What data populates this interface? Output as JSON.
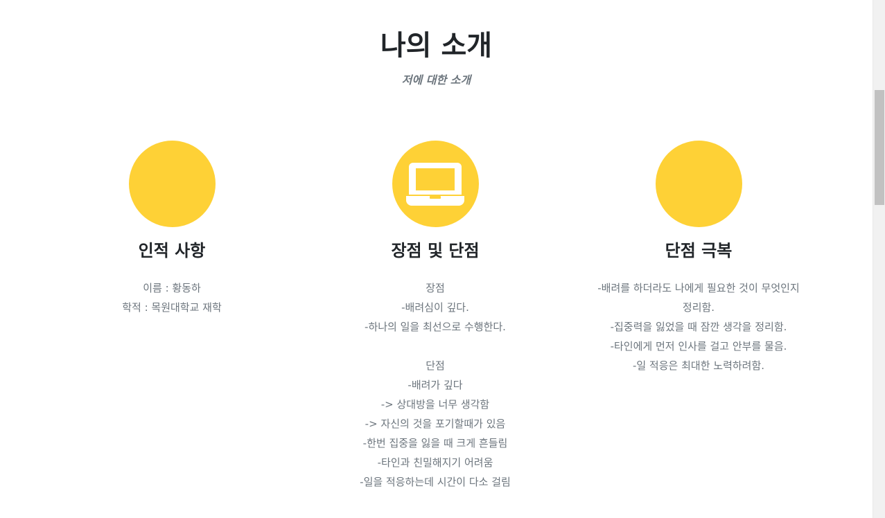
{
  "header": {
    "title": "나의 소개",
    "subtitle": "저에 대한 소개"
  },
  "columns": [
    {
      "heading": "인적 사항",
      "icon": "none",
      "lines": [
        "이름 : 황동하",
        "학적 : 목원대학교 재학"
      ]
    },
    {
      "heading": "장점 및 단점",
      "icon": "laptop-icon",
      "lines": [
        "장점",
        "-배려심이 깊다.",
        "-하나의 일을 최선으로 수행한다.",
        "",
        "단점",
        "-배려가 깊다",
        "-> 상대방을 너무 생각함",
        "-> 자신의 것을 포기할때가 있음",
        "-한번 집중을 잃을 때 크게 흔들림",
        "-타인과 친밀해지기 어려움",
        "-일을 적응하는데 시간이 다소 걸림"
      ]
    },
    {
      "heading": "단점 극복",
      "icon": "none",
      "lines": [
        "-배려를 하더라도 나에게 필요한 것이 무엇인지",
        "정리함.",
        "-집중력을 잃었을 때 잠깐 생각을 정리함.",
        "-타인에게 먼저 인사를 걸고 안부를 물음.",
        "-일 적응은 최대한 노력하려함."
      ]
    }
  ],
  "colors": {
    "accent": "#fed136",
    "heading": "#212529",
    "muted": "#6c757d"
  }
}
